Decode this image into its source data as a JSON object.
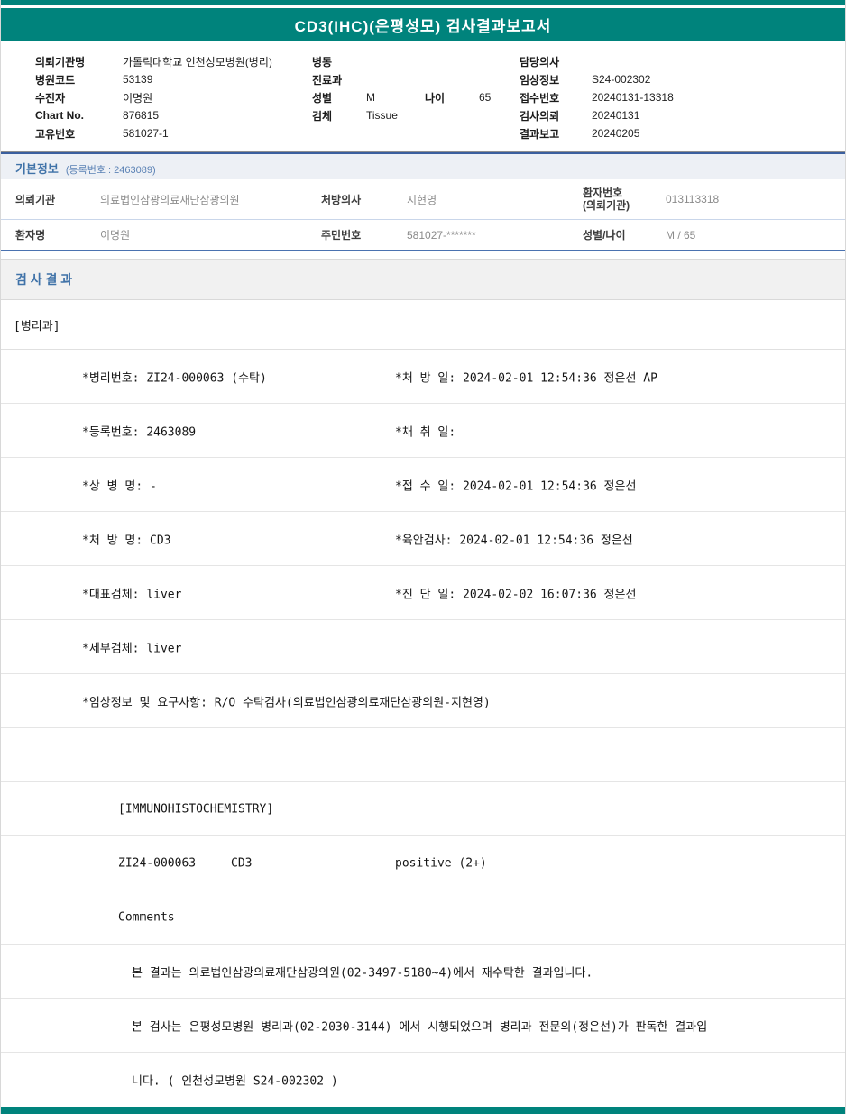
{
  "colors": {
    "teal": "#00837C",
    "blue": "#3F72A8"
  },
  "header": {
    "title": "CD3(IHC)(은평성모) 검사결과보고서"
  },
  "top_info": {
    "left": [
      {
        "label": "의뢰기관명",
        "value": "가톨릭대학교 인천성모병원(병리)"
      },
      {
        "label": "병원코드",
        "value": "53139"
      },
      {
        "label": "수진자",
        "value": "이명원"
      },
      {
        "label": "Chart No.",
        "value": "876815"
      },
      {
        "label": "고유번호",
        "value": "581027-1"
      }
    ],
    "middle": {
      "ward_label": "병동",
      "ward_value": "",
      "dept_label": "진료과",
      "dept_value": "",
      "sex_label": "성별",
      "sex_value": "M",
      "age_label": "나이",
      "age_value": "65",
      "specimen_label": "검체",
      "specimen_value": "Tissue"
    },
    "right": [
      {
        "label": "담당의사",
        "value": ""
      },
      {
        "label": "임상정보",
        "value": "S24-002302"
      },
      {
        "label": "접수번호",
        "value": "20240131-13318"
      },
      {
        "label": "검사의뢰",
        "value": "20240131"
      },
      {
        "label": "결과보고",
        "value": "20240205"
      }
    ]
  },
  "basic_info": {
    "title": "기본정보",
    "subtitle": "(등록번호 : 2463089)",
    "row1": {
      "c1_label": "의뢰기관",
      "c1_value": "의료법인삼광의료재단삼광의원",
      "c2_label": "처방의사",
      "c2_value": "지현영",
      "c3_label_line1": "환자번호",
      "c3_label_line2": "(의뢰기관)",
      "c3_value": "013113318"
    },
    "row2": {
      "c1_label": "환자명",
      "c1_value": "이명원",
      "c2_label": "주민번호",
      "c2_value": "581027-*******",
      "c3_label": "성별/나이",
      "c3_value": "M / 65"
    }
  },
  "results": {
    "title": "검 사 결 과",
    "department": "[병리과]",
    "rows": [
      {
        "left": "*병리번호: ZI24-000063 (수탁)",
        "right": "*처 방 일: 2024-02-01 12:54:36 정은선 AP"
      },
      {
        "left": "*등록번호: 2463089",
        "right": "*채 취 일:"
      },
      {
        "left": "*상 병 명: -",
        "right": "*접 수 일: 2024-02-01 12:54:36  정은선"
      },
      {
        "left": "*처 방 명: CD3",
        "right": "*육안검사: 2024-02-01 12:54:36  정은선"
      },
      {
        "left": "*대표검체: liver",
        "right": "*진 단 일: 2024-02-02 16:07:36  정은선"
      },
      {
        "left": "*세부검체: liver",
        "right": ""
      },
      {
        "left": "*임상정보 및 요구사항: R/O 수탁검사(의료법인삼광의료재단삼광의원-지현영)",
        "right": ""
      }
    ],
    "ihc": {
      "header": "[IMMUNOHISTOCHEMISTRY]",
      "specimen_no": "ZI24-000063",
      "test_name": "CD3",
      "result": "positive (2+)",
      "comments_label": "Comments",
      "comment_lines": [
        "본 결과는 의료법인삼광의료재단삼광의원(02-3497-5180~4)에서 재수탁한 결과입니다.",
        "본 검사는 은평성모병원 병리과(02-2030-3144) 에서 시행되었으며 병리과 전문의(정은선)가 판독한 결과입",
        "니다. ( 인천성모병원 S24-002302 )"
      ]
    }
  }
}
